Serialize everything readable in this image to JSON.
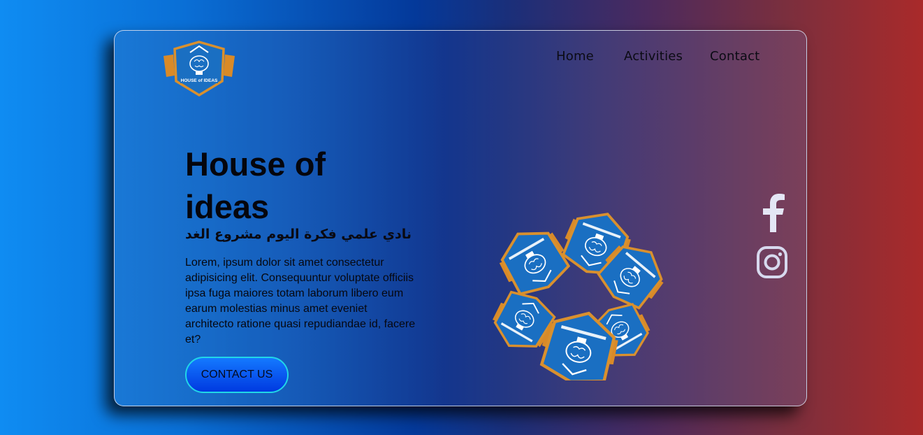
{
  "brand": {
    "logo_text": "HOUSE of IDEAS",
    "colors": {
      "shield_blue": "#1a6fc2",
      "shield_border": "#d9902e",
      "accent_cyan": "#21d6e8"
    }
  },
  "nav": {
    "items": [
      {
        "label": "Home"
      },
      {
        "label": "Activities"
      },
      {
        "label": "Contact"
      }
    ]
  },
  "hero": {
    "title": "House of ideas",
    "subtitle_arabic": "نادي علمي فكرة اليوم مشروع الغد",
    "description": "Lorem, ipsum dolor sit amet consectetur adipisicing elit. Consequuntur voluptate officiis ipsa fuga maiores totam laborum libero eum earum molestias minus amet eveniet architecto ratione quasi repudiandae id, facere et?",
    "cta_label": "CONTACT US",
    "illustration": "rotating-logo-ring"
  },
  "social": [
    {
      "name": "facebook",
      "icon": "facebook-icon"
    },
    {
      "name": "instagram",
      "icon": "instagram-icon"
    }
  ]
}
